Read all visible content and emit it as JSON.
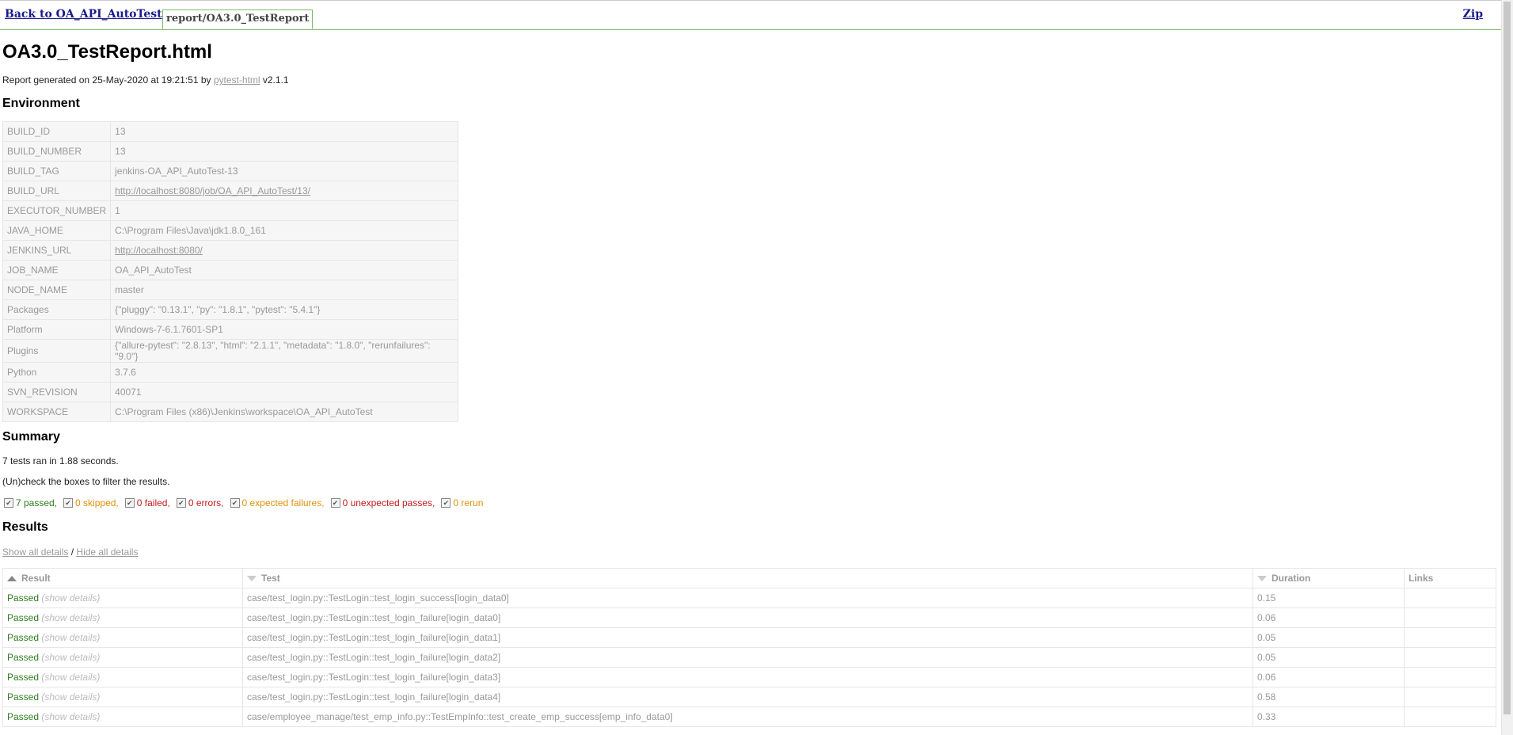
{
  "topbar": {
    "back_label": "Back to OA_API_AutoTest",
    "tab_label": "report/OA3.0_TestReport",
    "zip_label": "Zip"
  },
  "report": {
    "title": "OA3.0_TestReport.html",
    "generated_prefix": "Report generated on 25-May-2020 at 19:21:51 by ",
    "generated_link": "pytest-html",
    "generated_suffix": " v2.1.1"
  },
  "environment": {
    "heading": "Environment",
    "rows": [
      {
        "key": "BUILD_ID",
        "value": "13"
      },
      {
        "key": "BUILD_NUMBER",
        "value": "13"
      },
      {
        "key": "BUILD_TAG",
        "value": "jenkins-OA_API_AutoTest-13"
      },
      {
        "key": "BUILD_URL",
        "value": "http://localhost:8080/job/OA_API_AutoTest/13/"
      },
      {
        "key": "EXECUTOR_NUMBER",
        "value": "1"
      },
      {
        "key": "JAVA_HOME",
        "value": "C:\\Program Files\\Java\\jdk1.8.0_161"
      },
      {
        "key": "JENKINS_URL",
        "value": "http://localhost:8080/"
      },
      {
        "key": "JOB_NAME",
        "value": "OA_API_AutoTest"
      },
      {
        "key": "NODE_NAME",
        "value": "master"
      },
      {
        "key": "Packages",
        "value": "{\"pluggy\": \"0.13.1\", \"py\": \"1.8.1\", \"pytest\": \"5.4.1\"}"
      },
      {
        "key": "Platform",
        "value": "Windows-7-6.1.7601-SP1"
      },
      {
        "key": "Plugins",
        "value": "{\"allure-pytest\": \"2.8.13\", \"html\": \"2.1.1\", \"metadata\": \"1.8.0\", \"rerunfailures\": \"9.0\"}"
      },
      {
        "key": "Python",
        "value": "3.7.6"
      },
      {
        "key": "SVN_REVISION",
        "value": "40071"
      },
      {
        "key": "WORKSPACE",
        "value": "C:\\Program Files (x86)\\Jenkins\\workspace\\OA_API_AutoTest"
      }
    ]
  },
  "summary": {
    "heading": "Summary",
    "ran": "7 tests ran in 1.88 seconds.",
    "uncheck": "(Un)check the boxes to filter the results.",
    "filters": [
      {
        "label": "7 passed",
        "color": "#2e7d1f"
      },
      {
        "label": "0 skipped",
        "color": "#e0910a"
      },
      {
        "label": "0 failed",
        "color": "#c51b1b"
      },
      {
        "label": "0 errors",
        "color": "#c51b1b"
      },
      {
        "label": "0 expected failures",
        "color": "#e0910a"
      },
      {
        "label": "0 unexpected passes",
        "color": "#c51b1b"
      },
      {
        "label": "0 rerun",
        "color": "#e0910a"
      }
    ]
  },
  "results": {
    "heading": "Results",
    "show_all": "Show all details",
    "separator": " / ",
    "hide_all": "Hide all details",
    "columns": [
      "Result",
      "Test",
      "Duration",
      "Links"
    ],
    "show_details_label": "(show details)",
    "rows": [
      {
        "result": "Passed",
        "test": "case/test_login.py::TestLogin::test_login_success[login_data0]",
        "duration": "0.15",
        "links": ""
      },
      {
        "result": "Passed",
        "test": "case/test_login.py::TestLogin::test_login_failure[login_data0]",
        "duration": "0.06",
        "links": ""
      },
      {
        "result": "Passed",
        "test": "case/test_login.py::TestLogin::test_login_failure[login_data1]",
        "duration": "0.05",
        "links": ""
      },
      {
        "result": "Passed",
        "test": "case/test_login.py::TestLogin::test_login_failure[login_data2]",
        "duration": "0.05",
        "links": ""
      },
      {
        "result": "Passed",
        "test": "case/test_login.py::TestLogin::test_login_failure[login_data3]",
        "duration": "0.06",
        "links": ""
      },
      {
        "result": "Passed",
        "test": "case/test_login.py::TestLogin::test_login_failure[login_data4]",
        "duration": "0.58",
        "links": ""
      },
      {
        "result": "Passed",
        "test": "case/employee_manage/test_emp_info.py::TestEmpInfo::test_create_emp_success[emp_info_data0]",
        "duration": "0.33",
        "links": ""
      }
    ]
  }
}
